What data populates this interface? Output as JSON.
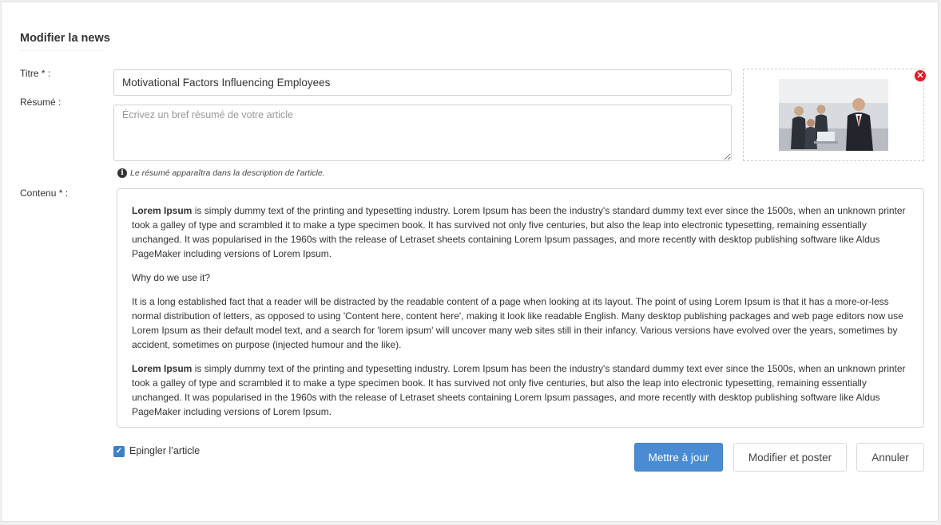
{
  "form": {
    "heading": "Modifier la news",
    "titre_label": "Titre * :",
    "titre_value": "Motivational Factors Influencing Employees",
    "resume_label": "Résumé :",
    "resume_placeholder": "Écrivez un bref résumé de votre article",
    "resume_hint": "Le résumé apparaîtra dans la description de l'article.",
    "contenu_label": "Contenu * :"
  },
  "image": {
    "remove_icon": "close-circle-icon"
  },
  "editor": {
    "p1_bold": "Lorem Ipsum",
    "p1_text": " is simply dummy text of the printing and typesetting industry. Lorem Ipsum has been the industry's standard dummy text ever since the 1500s, when an unknown printer took a galley of type and scrambled it to make a type specimen book. It has survived not only five centuries, but also the leap into electronic typesetting, remaining essentially unchanged. It was popularised in the 1960s with the release of Letraset sheets containing Lorem Ipsum passages, and more recently with desktop publishing software like Aldus PageMaker including versions of Lorem Ipsum.",
    "p2_text": "Why do we use it?",
    "p3_text": "It is a long established fact that a reader will be distracted by the readable content of a page when looking at its layout. The point of using Lorem Ipsum is that it has a more-or-less normal distribution of letters, as opposed to using 'Content here, content here', making it look like readable English. Many desktop publishing packages and web page editors now use Lorem Ipsum as their default model text, and a search for 'lorem ipsum' will uncover many web sites still in their infancy. Various versions have evolved over the years, sometimes by accident, sometimes on purpose (injected humour and the like).",
    "p4_bold": "Lorem Ipsum",
    "p4_text": " is simply dummy text of the printing and typesetting industry. Lorem Ipsum has been the industry's standard dummy text ever since the 1500s, when an unknown printer took a galley of type and scrambled it to make a type specimen book. It has survived not only five centuries, but also the leap into electronic typesetting, remaining essentially unchanged. It was popularised in the 1960s with the release of Letraset sheets containing Lorem Ipsum passages, and more recently with desktop publishing software like Aldus PageMaker including versions of Lorem Ipsum."
  },
  "footer": {
    "pin_checked": true,
    "pin_label": "Epingler l’article",
    "btn_update": "Mettre à jour",
    "btn_post": "Modifier et poster",
    "btn_cancel": "Annuler"
  },
  "colors": {
    "primary": "#4a8cd4",
    "danger": "#e01b24"
  }
}
